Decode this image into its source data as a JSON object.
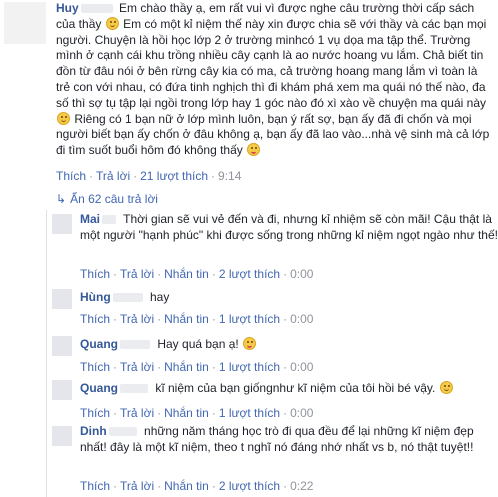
{
  "main_comment": {
    "author": "Huy",
    "text_1": "Em chào thầy ạ, em rất vui vì được nghe câu trường thời cấp sách của thầy",
    "text_2": "Em có một kỉ niệm thế này xin được chia sẽ với thầy và các bạn mọi người. Chuyện là hồi học lớp 2 ở trường minhcó 1 vụ dọa ma tập thể. Trường mình ở cạnh cái khu trồng nhiều cây cạnh là ao nước hoang vu lắm. Chả biết tin đồn từ đâu nói ở bên rừng cây kia có ma, cả trường hoang mang lắm vì toàn là trẻ con với nhau, có đứa tinh nghịch thì đi khám phá xem ma quái nó thế nào, đa số thì sợ tụ tập lại ngồi trong lớp hay 1 góc nào đó xì xào về chuyện ma quái này",
    "text_3": "Riêng có 1 bạn nữ ở lớp mình luôn, bạn ý rất sợ, bạn ấy đã đi chốn và mọi người biết bạn ấy chốn ở đâu không ạ, bạn ấy đã lao vào...nhà vệ sinh mà cả lớp đi tìm suốt buổi hôm đó không thấy",
    "like": "Thích",
    "reply": "Trả lời",
    "reply_count": "21 lượt thích",
    "time": "9:14"
  },
  "replies_toggle": {
    "arrow": "↳",
    "label": "Ẩn 62 câu trả lời"
  },
  "actions": {
    "like": "Thích",
    "reply": "Trả lời",
    "message": "Nhắn tin",
    "sep": "·"
  },
  "replies": [
    {
      "author": "Mai",
      "text": "Thời gian sẽ vui vẻ đến và đi, nhưng kỉ nhiệm sẽ còn mãi! Cậu thật là một người \"hạnh phúc\" khi được sống trong những kỉ niệm ngọt ngào như thế!",
      "likes": "2 lượt thích",
      "time": "0:00"
    },
    {
      "author": "Hùng",
      "text": "hay",
      "likes": "1 lượt thích",
      "time": "0:00"
    },
    {
      "author": "Quang",
      "text": "Hay quá bạn ạ!",
      "likes": "1 lượt thích",
      "time": "0:00"
    },
    {
      "author": "Quang",
      "text": "kĩ niệm của bạn giốngnhư kĩ niệm của tôi hồi bé vậy.",
      "likes": "1 lượt thích",
      "time": "0:00"
    },
    {
      "author": "Dinh",
      "text": "những năm tháng học trò đi qua đều để lại những kĩ niệm đẹp nhất! đây là một kĩ niệm, theo t nghĩ nó đáng nhớ nhất vs b, nó thật tuyệt!!",
      "likes": "2 lượt thích",
      "time": "0:22"
    }
  ]
}
